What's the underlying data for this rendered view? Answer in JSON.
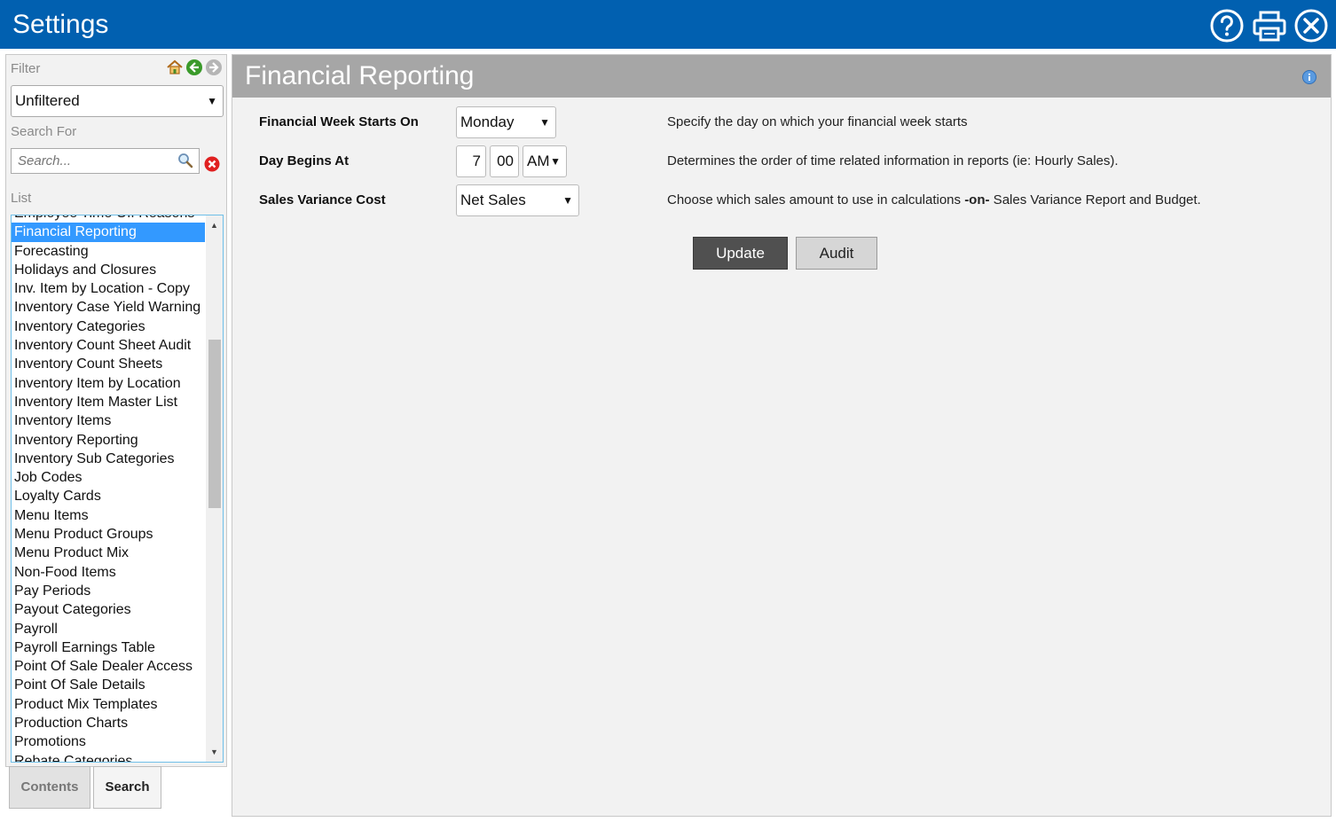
{
  "header": {
    "title": "Settings",
    "icons": [
      "help-icon",
      "print-icon",
      "close-icon"
    ]
  },
  "sidebar": {
    "filter_label": "Filter",
    "filter_value": "Unfiltered",
    "search_label": "Search For",
    "search_placeholder": "Search...",
    "list_label": "List",
    "list_items": [
      "Employee Time Off Reasons",
      "Financial Reporting",
      "Forecasting",
      "Holidays and Closures",
      "Inv. Item by Location - Copy",
      "Inventory Case Yield Warning",
      "Inventory Categories",
      "Inventory Count Sheet Audit",
      "Inventory Count Sheets",
      "Inventory Item by Location",
      "Inventory Item Master List",
      "Inventory Items",
      "Inventory Reporting",
      "Inventory Sub Categories",
      "Job Codes",
      "Loyalty Cards",
      "Menu Items",
      "Menu Product Groups",
      "Menu Product Mix",
      "Non-Food Items",
      "Pay Periods",
      "Payout Categories",
      "Payroll",
      "Payroll Earnings Table",
      "Point Of Sale Dealer Access",
      "Point Of Sale Details",
      "Product Mix Templates",
      "Production Charts",
      "Promotions",
      "Rebate Categories"
    ],
    "selected_item": "Financial Reporting",
    "tabs": {
      "contents": "Contents",
      "search": "Search"
    }
  },
  "main": {
    "title": "Financial Reporting",
    "fields": {
      "week_start": {
        "label": "Financial Week Starts On",
        "value": "Monday",
        "description": "Specify the day on which your financial week starts"
      },
      "day_begins": {
        "label": "Day Begins At",
        "hour": "7",
        "minute": "00",
        "ampm": "AM",
        "description": "Determines the order of time related information in reports (ie: Hourly Sales)."
      },
      "variance_cost": {
        "label": "Sales Variance Cost",
        "value": "Net Sales",
        "description_pre": "Choose which sales amount to use in calculations ",
        "description_bold": "-on-",
        "description_post": " Sales Variance Report and Budget."
      }
    },
    "buttons": {
      "update": "Update",
      "audit": "Audit"
    }
  },
  "colors": {
    "header_bg": "#0160b0",
    "panel_header_bg": "#a6a6a6",
    "selected_bg": "#3399ff",
    "clear_red": "#e02020"
  }
}
